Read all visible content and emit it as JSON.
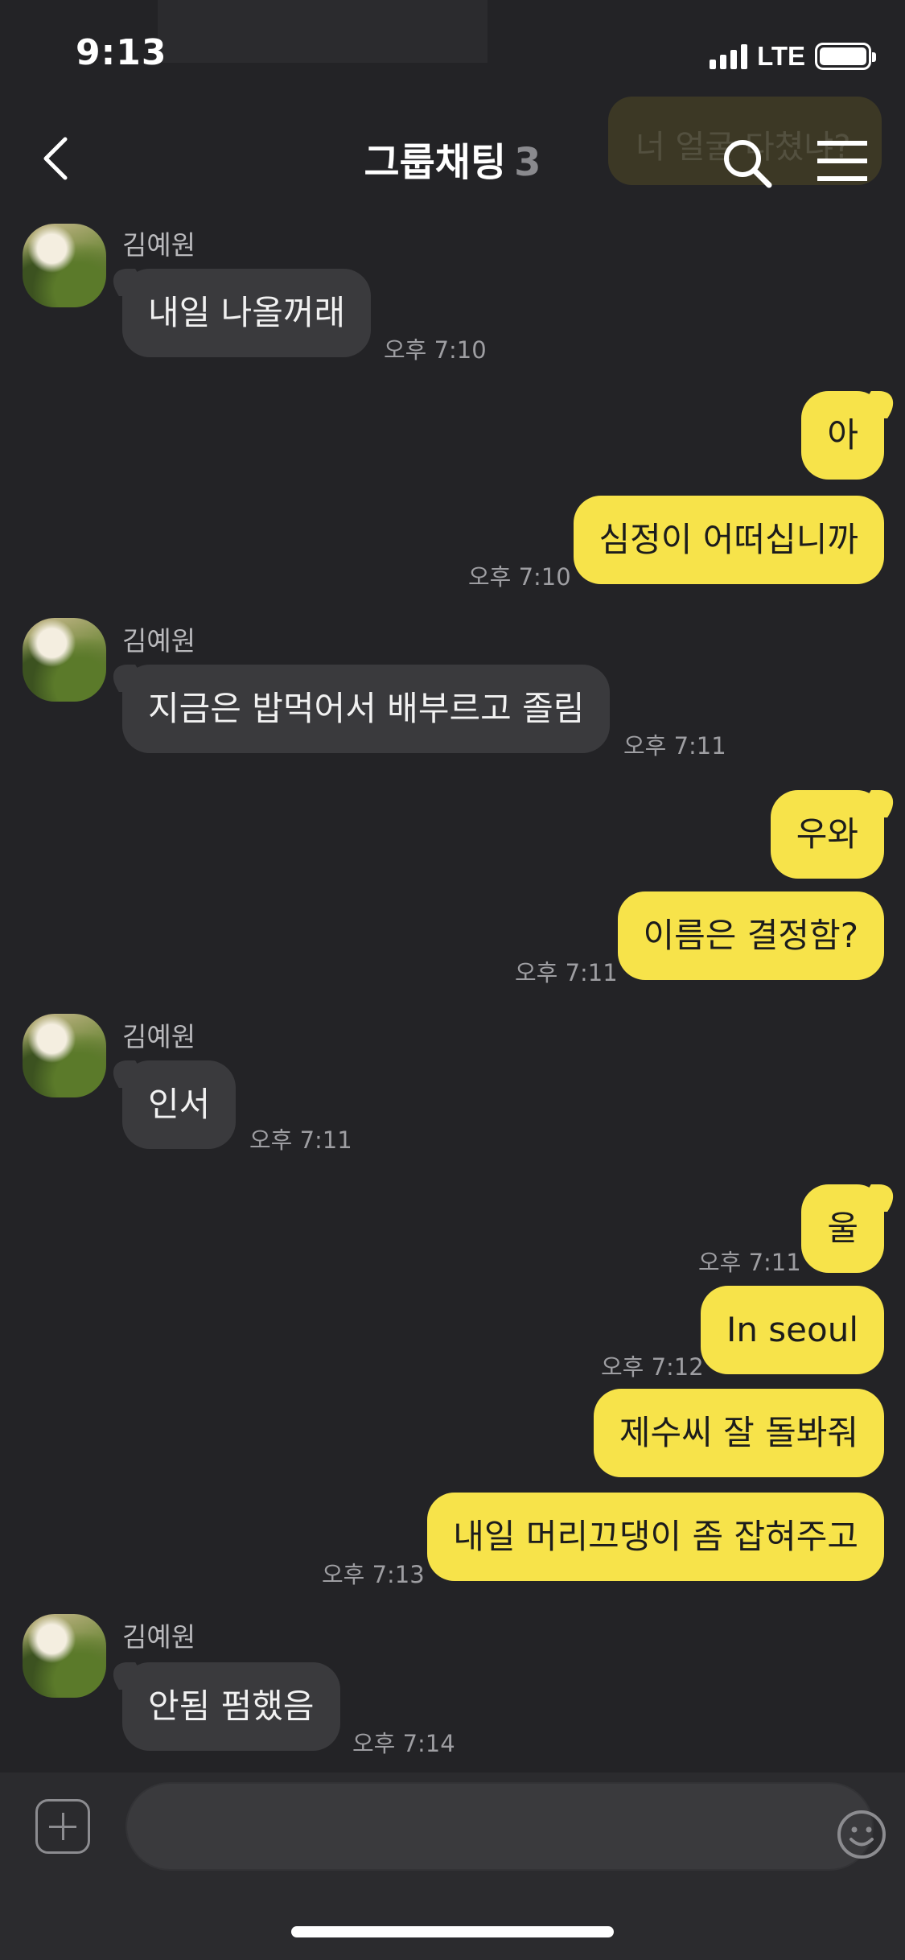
{
  "status": {
    "time": "9:13",
    "network": "LTE"
  },
  "header": {
    "title": "그룹채팅",
    "member_count": "3",
    "ghost_message": "너 얼굴 다쳤냐?"
  },
  "messages": [
    {
      "sender": "김예원",
      "text": "내일 나올꺼래",
      "time": "오후 7:10"
    },
    {
      "text": "아",
      "time": ""
    },
    {
      "text": "심정이 어떠십니까",
      "time": "오후 7:10"
    },
    {
      "sender": "김예원",
      "text": "지금은 밥먹어서 배부르고 졸림",
      "time": "오후 7:11"
    },
    {
      "text": "우와",
      "time": ""
    },
    {
      "text": "이름은 결정함?",
      "time": "오후 7:11"
    },
    {
      "sender": "김예원",
      "text": "인서",
      "time": "오후 7:11"
    },
    {
      "text": "울",
      "time": "오후 7:11"
    },
    {
      "text": "In seoul",
      "time": "오후 7:12"
    },
    {
      "text": "제수씨 잘 돌봐줘",
      "time": ""
    },
    {
      "text": "내일 머리끄댕이 좀 잡혀주고",
      "time": "오후 7:13"
    },
    {
      "sender": "김예원",
      "text": "안됨 펌했음",
      "time": "오후 7:14"
    }
  ],
  "input": {
    "placeholder": ""
  },
  "icons": {
    "back": "chevron-left-icon",
    "search": "search-icon",
    "menu": "hamburger-menu-icon",
    "plus": "plus-icon",
    "emoji": "smiley-icon",
    "hashtag": "hashtag-icon"
  },
  "colors": {
    "background": "#232326",
    "incoming_bubble": "#3a3a3d",
    "outgoing_bubble": "#f7e34a"
  }
}
